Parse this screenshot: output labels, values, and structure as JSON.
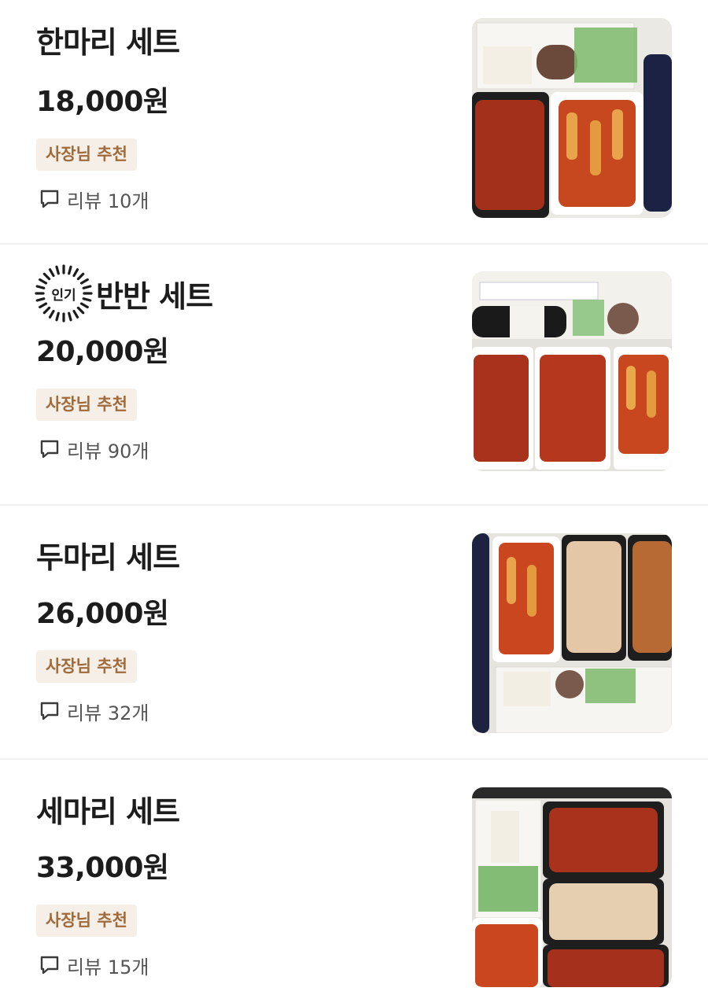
{
  "menu": {
    "items": [
      {
        "name": "한마리 세트",
        "price": "18,000원",
        "badge": "사장님 추천",
        "review_label": "리뷰",
        "review_count": "10개",
        "image_icon": "chicken-set-photo"
      },
      {
        "name": "반반 세트",
        "popular_label": "인기",
        "price": "20,000원",
        "badge": "사장님 추천",
        "review_label": "리뷰",
        "review_count": "90개",
        "image_icon": "chicken-set-photo"
      },
      {
        "name": "두마리 세트",
        "price": "26,000원",
        "badge": "사장님 추천",
        "review_label": "리뷰",
        "review_count": "32개",
        "image_icon": "chicken-set-photo"
      },
      {
        "name": "세마리 세트",
        "price": "33,000원",
        "badge": "사장님 추천",
        "review_label": "리뷰",
        "review_count": "15개",
        "image_icon": "chicken-set-photo"
      }
    ]
  },
  "colors": {
    "badge_bg": "#f5efe8",
    "badge_text": "#a06a3a",
    "divider": "#f1f1f1",
    "sauce_red": "#b8321c",
    "fried_chicken": "#d9a06a"
  }
}
